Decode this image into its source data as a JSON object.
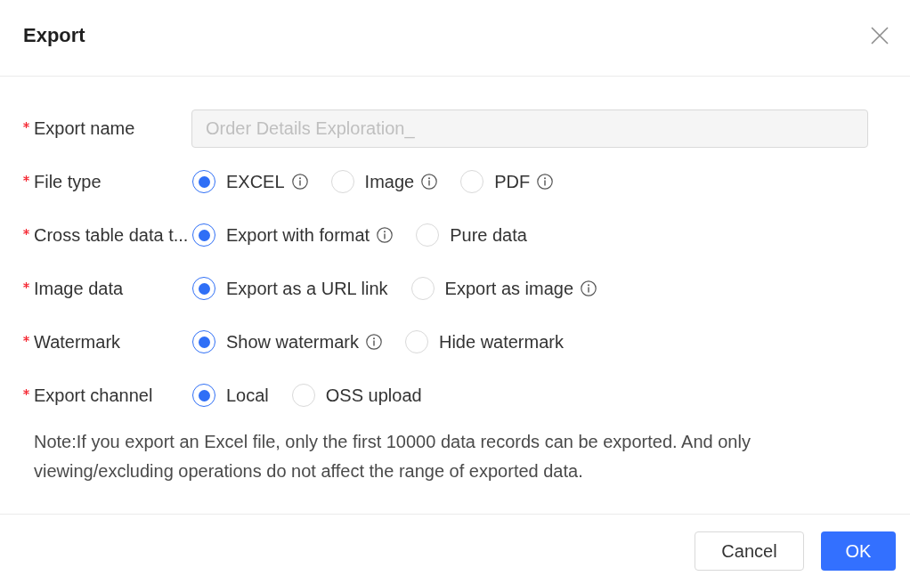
{
  "dialog": {
    "title": "Export"
  },
  "fields": [
    {
      "kind": "text",
      "label": "Export name",
      "required": true,
      "value": "Order Details Exploration_",
      "disabled": true
    },
    {
      "kind": "radio",
      "label": "File type",
      "required": true,
      "options": [
        {
          "label": "EXCEL",
          "info": true,
          "selected": true
        },
        {
          "label": "Image",
          "info": true,
          "selected": false
        },
        {
          "label": "PDF",
          "info": true,
          "selected": false
        }
      ]
    },
    {
      "kind": "radio",
      "label": "Cross table data t...",
      "required": true,
      "options": [
        {
          "label": "Export with format",
          "info": true,
          "selected": true
        },
        {
          "label": "Pure data",
          "info": false,
          "selected": false
        }
      ]
    },
    {
      "kind": "radio",
      "label": "Image data",
      "required": true,
      "options": [
        {
          "label": "Export as a URL link",
          "info": false,
          "selected": true
        },
        {
          "label": "Export as image",
          "info": true,
          "selected": false
        }
      ]
    },
    {
      "kind": "radio",
      "label": "Watermark",
      "required": true,
      "options": [
        {
          "label": "Show watermark",
          "info": true,
          "selected": true
        },
        {
          "label": "Hide watermark",
          "info": false,
          "selected": false
        }
      ]
    },
    {
      "kind": "radio",
      "label": "Export channel",
      "required": true,
      "options": [
        {
          "label": "Local",
          "info": false,
          "selected": true
        },
        {
          "label": "OSS upload",
          "info": false,
          "selected": false
        }
      ]
    }
  ],
  "note": "Note:If you export an Excel file, only the first 10000 data records can be exported. And only viewing/excluding operations do not affect the range of exported data.",
  "buttons": [
    {
      "label": "Cancel",
      "kind": "secondary"
    },
    {
      "label": "OK",
      "kind": "primary"
    }
  ]
}
